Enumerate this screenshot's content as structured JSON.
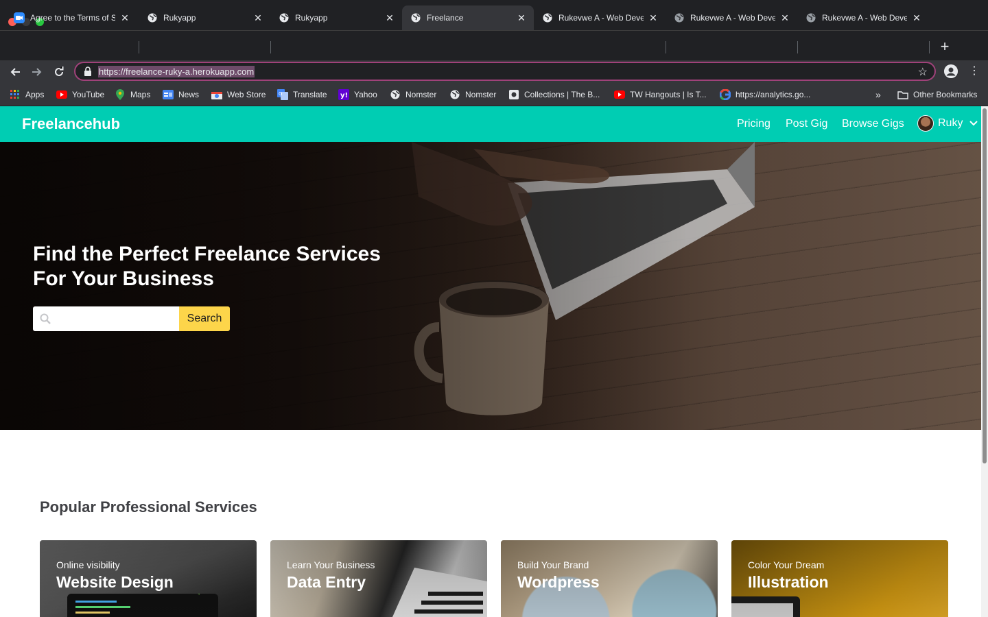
{
  "browser": {
    "tabs": [
      {
        "title": "Agree to the Terms of Se",
        "icon": "zoom-icon",
        "active": false
      },
      {
        "title": "Rukyapp",
        "icon": "globe-icon",
        "active": false
      },
      {
        "title": "Rukyapp",
        "icon": "globe-icon",
        "active": false
      },
      {
        "title": "Freelance",
        "icon": "globe-icon",
        "active": true
      },
      {
        "title": "Rukevwe A - Web Develo",
        "icon": "globe-icon",
        "active": false
      },
      {
        "title": "Rukevwe A - Web Develo",
        "icon": "globe-icon",
        "active": false
      },
      {
        "title": "Rukevwe A - Web Develo",
        "icon": "globe-icon",
        "active": false
      }
    ],
    "url": "https://freelance-ruky-a.herokuapp.com",
    "bookmarks": [
      {
        "label": "Apps",
        "icon": "apps-grid-icon"
      },
      {
        "label": "YouTube",
        "icon": "youtube-icon"
      },
      {
        "label": "Maps",
        "icon": "maps-pin-icon"
      },
      {
        "label": "News",
        "icon": "news-icon"
      },
      {
        "label": "Web Store",
        "icon": "webstore-icon"
      },
      {
        "label": "Translate",
        "icon": "translate-icon"
      },
      {
        "label": "Yahoo",
        "icon": "yahoo-icon"
      },
      {
        "label": "Nomster",
        "icon": "globe-icon"
      },
      {
        "label": "Nomster",
        "icon": "globe-icon"
      },
      {
        "label": "Collections | The B...",
        "icon": "collections-icon"
      },
      {
        "label": "TW Hangouts | Is T...",
        "icon": "youtube-icon"
      },
      {
        "label": "https://analytics.go...",
        "icon": "google-icon"
      }
    ],
    "other_bookmarks": "Other Bookmarks",
    "colors": {
      "chrome_dark": "#202124",
      "chrome_toolbar": "#35363a",
      "url_highlight": "#6e4c6a"
    }
  },
  "site": {
    "brand": "Freelancehub",
    "nav": [
      "Pricing",
      "Post Gig",
      "Browse Gigs"
    ],
    "user": "Ruky",
    "hero": {
      "headline": "Find the Perfect Freelance Services For Your Business",
      "search_placeholder": "",
      "search_button": "Search"
    },
    "section_title": "Popular Professional Services",
    "services": [
      {
        "subtitle": "Online visibility",
        "title": "Website Design"
      },
      {
        "subtitle": "Learn Your Business",
        "title": "Data Entry"
      },
      {
        "subtitle": "Build Your Brand",
        "title": "Wordpress"
      },
      {
        "subtitle": "Color Your Dream",
        "title": "Illustration"
      }
    ],
    "colors": {
      "nav_bg": "#00cdb3",
      "search_button": "#fdd54a",
      "heading": "#404145"
    }
  }
}
